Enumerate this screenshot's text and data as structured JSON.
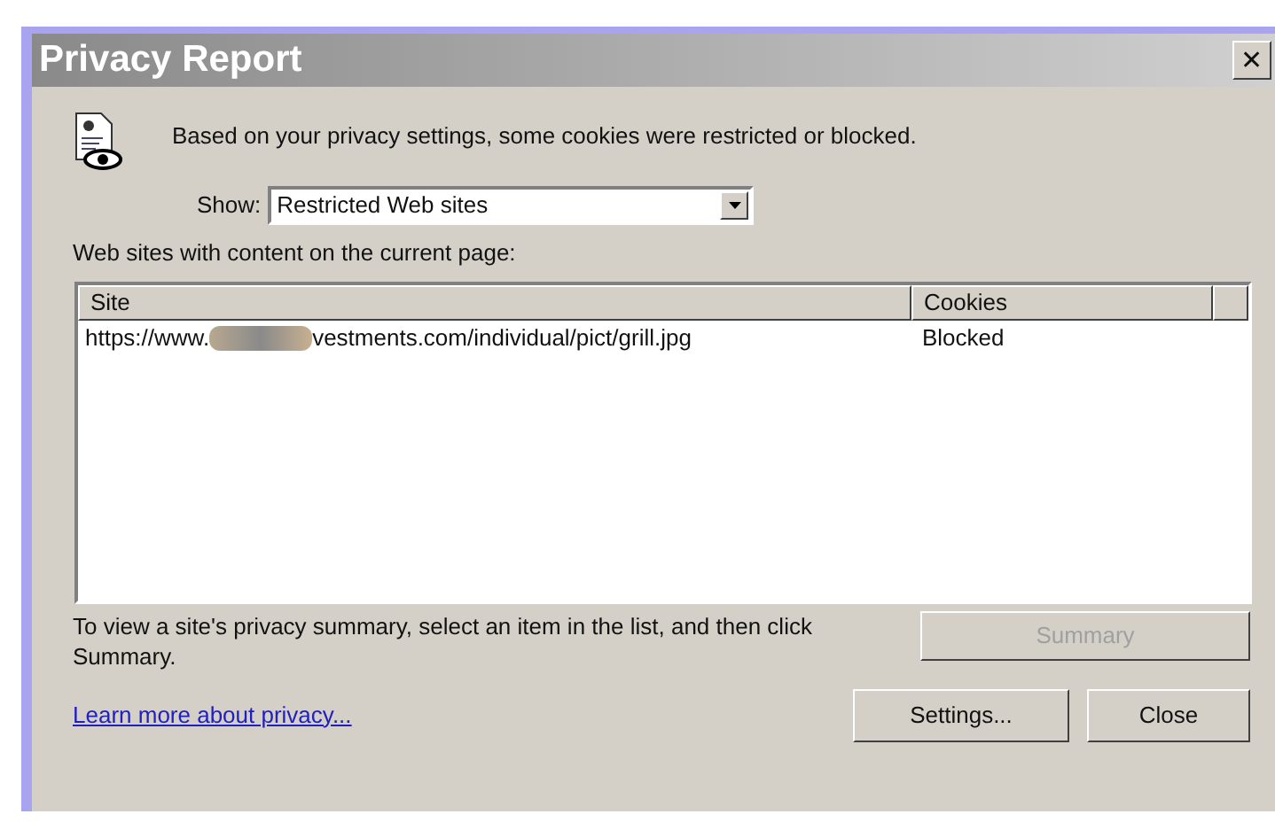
{
  "window": {
    "title": "Privacy Report",
    "close": "✕"
  },
  "message": "Based on your privacy settings, some cookies were restricted or blocked.",
  "show": {
    "label": "Show:",
    "value": "Restricted Web sites"
  },
  "list_label": "Web sites with content on the current page:",
  "table": {
    "columns": [
      "Site",
      "Cookies"
    ],
    "rows": [
      {
        "site_start": "https://www.",
        "site_end": "vestments.com/individual/pict/grill.jpg",
        "cookies": "Blocked",
        "selected": false
      }
    ]
  },
  "hint": "To view a site's privacy summary, select an item in the list, and then click Summary.",
  "summary_button": {
    "label": "Summary",
    "disabled": true
  },
  "link": "Learn more about privacy...",
  "buttons": [
    "Settings...",
    "Close"
  ]
}
